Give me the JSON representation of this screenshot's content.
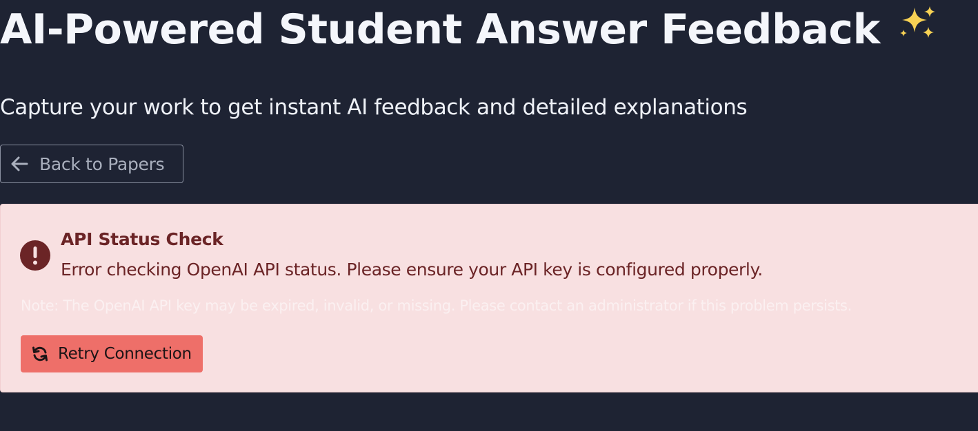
{
  "header": {
    "title": "AI-Powered Student Answer Feedback",
    "title_icon": "sparkles-icon",
    "subtitle": "Capture your work to get instant AI feedback and detailed explanations"
  },
  "navigation": {
    "back_label": "Back to Papers",
    "back_icon": "arrow-left-icon"
  },
  "alert": {
    "icon": "exclamation-circle-icon",
    "title": "API Status Check",
    "message": "Error checking OpenAI API status. Please ensure your API key is configured properly.",
    "note": "Note: The OpenAI API key may be expired, invalid, or missing. Please contact an administrator if this problem persists.",
    "retry_label": "Retry Connection",
    "retry_icon": "refresh-icon"
  },
  "colors": {
    "background": "#1e2333",
    "alert_background": "#f8e0e1",
    "alert_text": "#6b2426",
    "retry_button": "#ee6f69",
    "sparkle": "#f7d154"
  }
}
